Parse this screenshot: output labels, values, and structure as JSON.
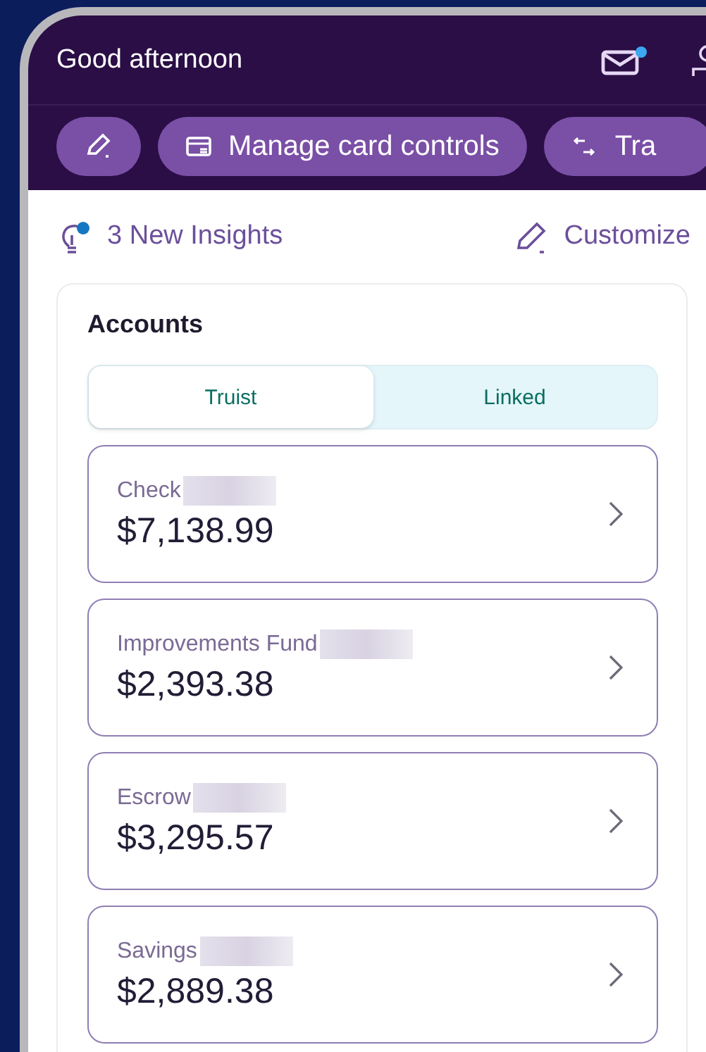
{
  "header": {
    "title": "Good afternoon",
    "mail_unread": true
  },
  "quick_actions": [
    {
      "kind": "edit"
    },
    {
      "kind": "card",
      "label": "Manage card controls"
    },
    {
      "kind": "transfer",
      "label": "Tra"
    }
  ],
  "insights": {
    "label": "3 New Insights",
    "unread": true
  },
  "customize": {
    "label": "Customize"
  },
  "accounts": {
    "title": "Accounts",
    "tabs": [
      {
        "label": "Truist",
        "selected": true
      },
      {
        "label": "Linked",
        "selected": false
      }
    ],
    "items": [
      {
        "name": "Check",
        "balance": "$7,138.99"
      },
      {
        "name": "Improvements Fund",
        "balance": "$2,393.38"
      },
      {
        "name": "Escrow",
        "balance": "$3,295.57"
      },
      {
        "name": "Savings",
        "balance": "$2,889.38"
      }
    ]
  }
}
